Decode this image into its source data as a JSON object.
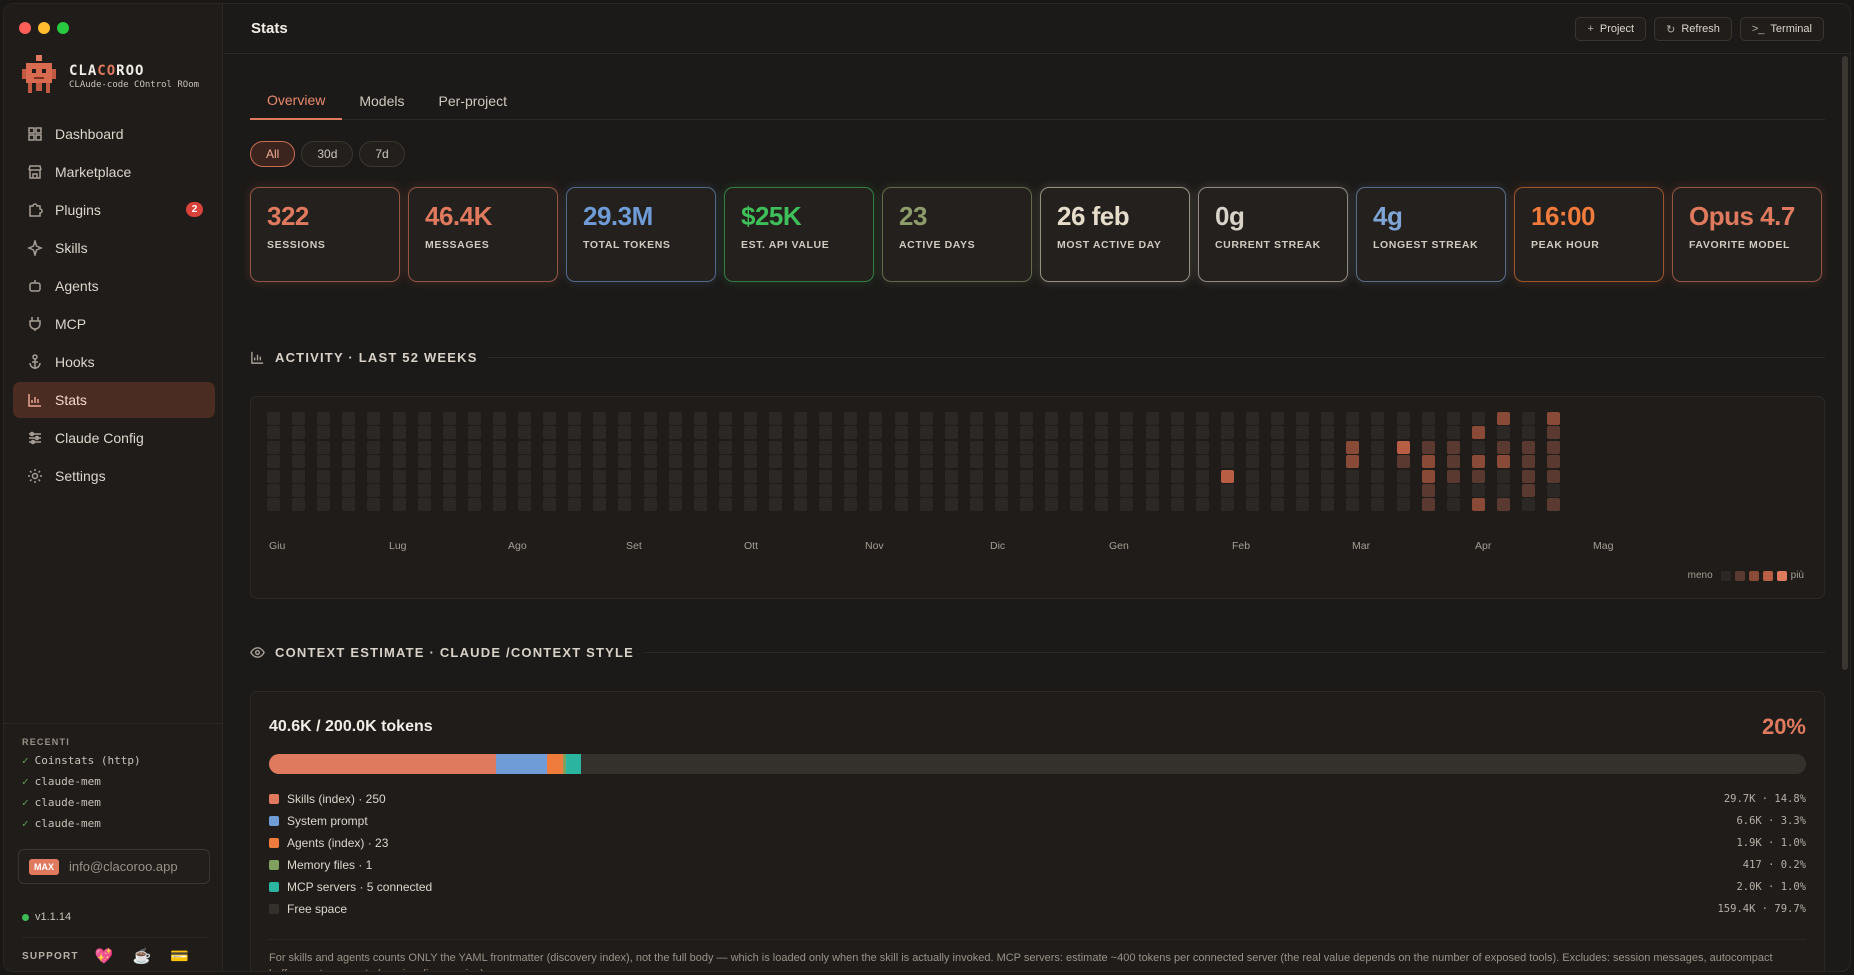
{
  "app": {
    "brand_prefix": "CLA",
    "brand_hl": "CO",
    "brand_suffix": "ROO",
    "brand_sub": "CLAude-code COntrol ROom"
  },
  "sidebar": {
    "items": [
      {
        "label": "Dashboard",
        "icon": "grid-icon"
      },
      {
        "label": "Marketplace",
        "icon": "store-icon"
      },
      {
        "label": "Plugins",
        "icon": "puzzle-icon",
        "badge": "2"
      },
      {
        "label": "Skills",
        "icon": "sparkle-icon"
      },
      {
        "label": "Agents",
        "icon": "bot-icon"
      },
      {
        "label": "MCP",
        "icon": "plug-icon"
      },
      {
        "label": "Hooks",
        "icon": "anchor-icon"
      },
      {
        "label": "Stats",
        "icon": "bar-chart-icon",
        "active": true
      },
      {
        "label": "Claude Config",
        "icon": "sliders-icon"
      },
      {
        "label": "Settings",
        "icon": "gear-icon"
      }
    ],
    "recent_title": "RECENTI",
    "recent": [
      "Coinstats (http)",
      "claude-mem",
      "claude-mem",
      "claude-mem"
    ],
    "plan_badge": "MAX",
    "email": "info@clacoroo.app",
    "version": "v1.1.14",
    "support_label": "SUPPORT"
  },
  "header": {
    "title": "Stats",
    "actions": [
      {
        "label": "Project",
        "glyph": "+"
      },
      {
        "label": "Refresh",
        "glyph": "↻"
      },
      {
        "label": "Terminal",
        "glyph": ">_"
      }
    ]
  },
  "tabs": [
    "Overview",
    "Models",
    "Per-project"
  ],
  "filters": [
    "All",
    "30d",
    "7d"
  ],
  "cards": [
    {
      "value": "322",
      "label": "Sessions",
      "color": "#e07a5f"
    },
    {
      "value": "46.4K",
      "label": "Messages",
      "color": "#e07a5f"
    },
    {
      "value": "29.3M",
      "label": "Total tokens",
      "color": "#6f9bd6"
    },
    {
      "value": "$25K",
      "label": "Est. API value",
      "color": "#3fbf5a"
    },
    {
      "value": "23",
      "label": "Active days",
      "color": "#8e9c6b"
    },
    {
      "value": "26 feb",
      "label": "Most active day",
      "color": "#e6dccb"
    },
    {
      "value": "0g",
      "label": "Current streak",
      "color": "#d9d2c8"
    },
    {
      "value": "4g",
      "label": "Longest streak",
      "color": "#7fa4d6"
    },
    {
      "value": "16:00",
      "label": "Peak hour",
      "color": "#ef7c3c"
    },
    {
      "value": "Opus 4.7",
      "label": "Favorite model",
      "color": "#e07a5f"
    }
  ],
  "activity": {
    "title": "ACTIVITY · LAST 52 WEEKS",
    "months": [
      "Giu",
      "Lug",
      "Ago",
      "Set",
      "Ott",
      "Nov",
      "Dic",
      "Gen",
      "Feb",
      "Mar",
      "Apr",
      "Mag"
    ],
    "legend_less": "meno",
    "legend_more": "più",
    "levels": [
      "#2b2825",
      "#5a3a30",
      "#8a4a38",
      "#b85e45",
      "#e07a5f"
    ],
    "cells": [
      [
        38,
        4,
        3
      ],
      [
        43,
        2,
        2
      ],
      [
        43,
        3,
        2
      ],
      [
        45,
        2,
        3
      ],
      [
        45,
        3,
        1
      ],
      [
        46,
        2,
        1
      ],
      [
        46,
        3,
        2
      ],
      [
        46,
        4,
        2
      ],
      [
        46,
        5,
        1
      ],
      [
        46,
        6,
        1
      ],
      [
        47,
        2,
        1
      ],
      [
        47,
        3,
        1
      ],
      [
        47,
        4,
        1
      ],
      [
        48,
        1,
        2
      ],
      [
        48,
        3,
        2
      ],
      [
        48,
        4,
        1
      ],
      [
        48,
        6,
        2
      ],
      [
        49,
        0,
        2
      ],
      [
        49,
        2,
        1
      ],
      [
        49,
        3,
        2
      ],
      [
        49,
        6,
        1
      ],
      [
        50,
        2,
        1
      ],
      [
        50,
        3,
        1
      ],
      [
        50,
        4,
        1
      ],
      [
        50,
        5,
        1
      ],
      [
        51,
        0,
        2
      ],
      [
        51,
        1,
        1
      ],
      [
        51,
        2,
        1
      ],
      [
        51,
        3,
        1
      ],
      [
        51,
        4,
        1
      ],
      [
        51,
        6,
        1
      ]
    ]
  },
  "context": {
    "title": "CONTEXT ESTIMATE · CLAUDE /CONTEXT STYLE",
    "total": "40.6K / 200.0K tokens",
    "percent": "20%",
    "segments": [
      {
        "label": "Skills (index) · 250",
        "value": "29.7K · 14.8%",
        "pct": 14.8,
        "color": "#e07a5f"
      },
      {
        "label": "System prompt",
        "value": "6.6K · 3.3%",
        "pct": 3.3,
        "color": "#6f9bd6"
      },
      {
        "label": "Agents (index) · 23",
        "value": "1.9K · 1.0%",
        "pct": 1.0,
        "color": "#ef7c3c"
      },
      {
        "label": "Memory files · 1",
        "value": "417 · 0.2%",
        "pct": 0.2,
        "color": "#7fa05f"
      },
      {
        "label": "MCP servers · 5 connected",
        "value": "2.0K · 1.0%",
        "pct": 1.0,
        "color": "#2bb5a0"
      },
      {
        "label": "Free space",
        "value": "159.4K · 79.7%",
        "pct": 79.7,
        "color": "#34302c"
      }
    ],
    "note": "For skills and agents counts ONLY the YAML frontmatter (discovery index), not the full body — which is loaded only when the skill is actually invoked. MCP servers: estimate ~400 tokens per connected server (the real value depends on the number of exposed tools). Excludes: session messages, autocompact buffer, custom agents (requires live session)."
  }
}
